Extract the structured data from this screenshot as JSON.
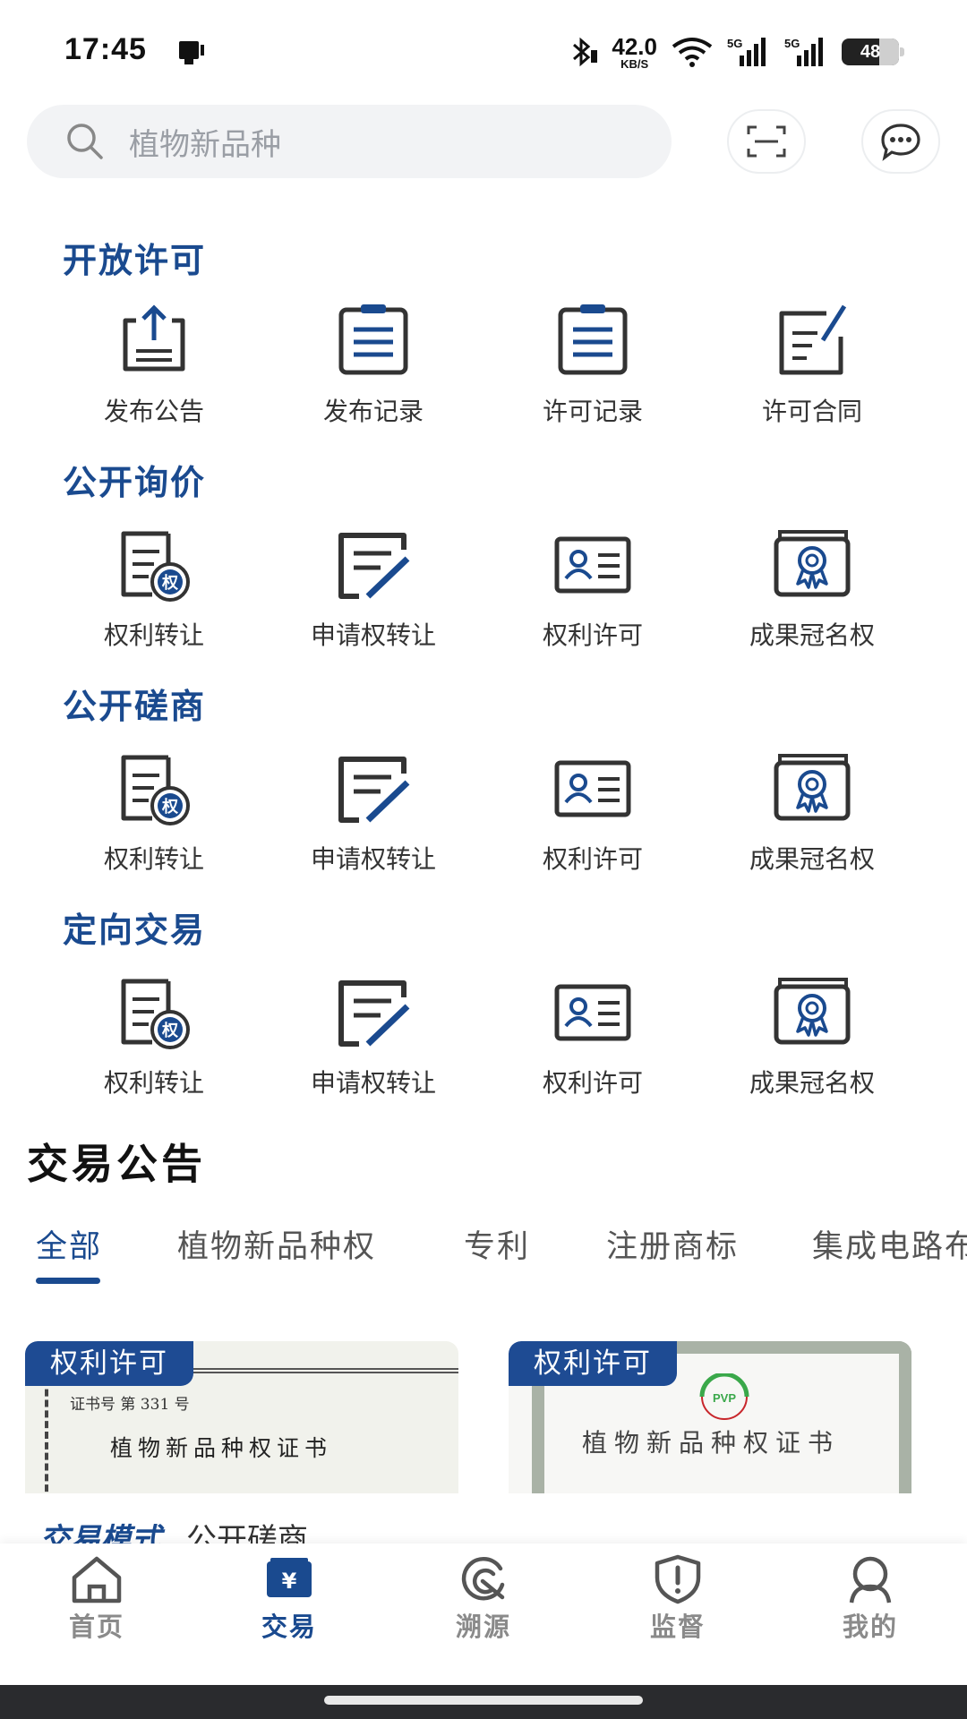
{
  "status_bar": {
    "time": "17:45",
    "net_speed_value": "42.0",
    "net_speed_unit": "KB/S",
    "network_labels": [
      "5G",
      "5G"
    ],
    "battery_level": "48",
    "icons": [
      "bluetooth-icon",
      "wifi-icon",
      "signal-icon",
      "signal-icon",
      "battery-icon"
    ]
  },
  "search": {
    "placeholder": "植物新品种"
  },
  "sections": [
    {
      "title": "开放许可",
      "items": [
        {
          "label": "发布公告",
          "icon": "upload-doc-icon"
        },
        {
          "label": "发布记录",
          "icon": "clipboard-list-icon"
        },
        {
          "label": "许可记录",
          "icon": "clipboard-list-icon"
        },
        {
          "label": "许可合同",
          "icon": "contract-edit-icon"
        }
      ]
    },
    {
      "title": "公开询价",
      "items": [
        {
          "label": "权利转让",
          "icon": "rights-doc-icon",
          "badge": "权"
        },
        {
          "label": "申请权转让",
          "icon": "edit-doc-icon"
        },
        {
          "label": "权利许可",
          "icon": "id-card-icon"
        },
        {
          "label": "成果冠名权",
          "icon": "award-card-icon"
        }
      ]
    },
    {
      "title": "公开磋商",
      "items": [
        {
          "label": "权利转让",
          "icon": "rights-doc-icon",
          "badge": "权"
        },
        {
          "label": "申请权转让",
          "icon": "edit-doc-icon"
        },
        {
          "label": "权利许可",
          "icon": "id-card-icon"
        },
        {
          "label": "成果冠名权",
          "icon": "award-card-icon"
        }
      ]
    },
    {
      "title": "定向交易",
      "items": [
        {
          "label": "权利转让",
          "icon": "rights-doc-icon",
          "badge": "权"
        },
        {
          "label": "申请权转让",
          "icon": "edit-doc-icon"
        },
        {
          "label": "权利许可",
          "icon": "id-card-icon"
        },
        {
          "label": "成果冠名权",
          "icon": "award-card-icon"
        }
      ]
    }
  ],
  "announcement": {
    "title": "交易公告",
    "tabs": [
      "全部",
      "植物新品种权",
      "专利",
      "注册商标",
      "集成电路布"
    ],
    "active_tab": "全部",
    "cards": [
      {
        "badge": "权利许可",
        "cert_no": "证书号  第  331  号",
        "cert_title": "植物新品种权证书"
      },
      {
        "badge": "权利许可",
        "logo_text": "PVP",
        "cert_title": "植物新品种权证书"
      }
    ],
    "trade_mode_label": "交易模式",
    "trade_mode_value": "公开磋商"
  },
  "bottom_nav": [
    {
      "label": "首页",
      "icon": "home-icon",
      "active": false
    },
    {
      "label": "交易",
      "icon": "trade-yen-icon",
      "active": true,
      "glyph": "¥"
    },
    {
      "label": "溯源",
      "icon": "trace-icon",
      "active": false
    },
    {
      "label": "监督",
      "icon": "shield-icon",
      "active": false
    },
    {
      "label": "我的",
      "icon": "profile-icon",
      "active": false
    }
  ],
  "colors": {
    "primary": "#1a4a8f",
    "icon_dark": "#333333",
    "nav_inactive": "#8a8a8a",
    "search_bg": "#f2f3f5"
  }
}
